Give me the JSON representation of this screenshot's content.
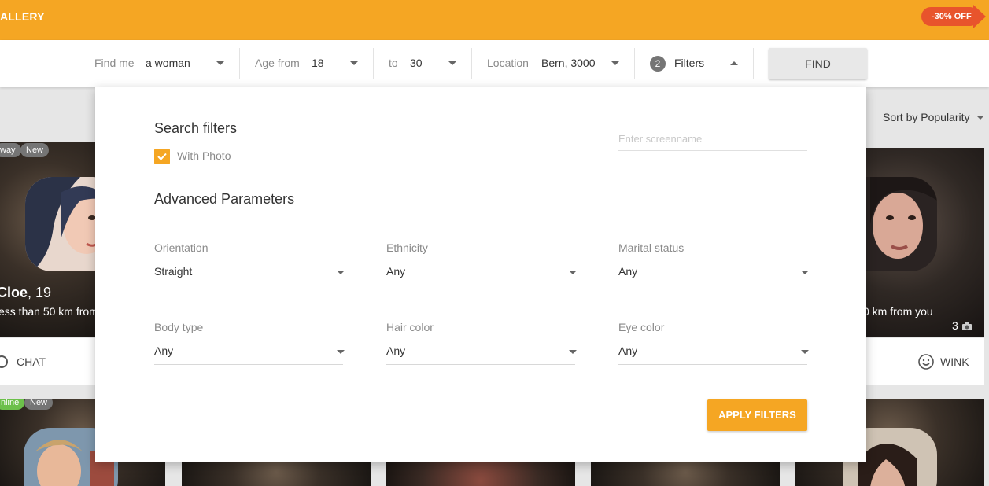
{
  "header": {
    "brand": "ALLERY",
    "promo": "-30% OFF"
  },
  "search": {
    "find_me_label": "Find me",
    "find_me_value": "a woman",
    "age_from_label": "Age from",
    "age_from_value": "18",
    "age_to_label": "to",
    "age_to_value": "30",
    "location_label": "Location",
    "location_value": "Bern, 3000",
    "filters_count": "2",
    "filters_label": "Filters",
    "find_button": "FIND"
  },
  "sort": {
    "label": "Sort by Popularity"
  },
  "cards": {
    "left": {
      "badge_1": "way",
      "badge_2": "New",
      "name": "Cloe",
      "age": ", 19",
      "distance": "ess than 50 km from",
      "action": "CHAT"
    },
    "right": {
      "distance": "0 km from you",
      "photo_count": "3",
      "action": "WINK"
    },
    "row2": {
      "badge_1": "nline",
      "badge_2": "New"
    }
  },
  "filter_panel": {
    "title": "Search filters",
    "with_photo_label": "With Photo",
    "with_photo_checked": true,
    "screenname_placeholder": "Enter screenname",
    "advanced_title": "Advanced Parameters",
    "params": [
      {
        "label": "Orientation",
        "value": "Straight"
      },
      {
        "label": "Ethnicity",
        "value": "Any"
      },
      {
        "label": "Marital status",
        "value": "Any"
      },
      {
        "label": "Body type",
        "value": "Any"
      },
      {
        "label": "Hair color",
        "value": "Any"
      },
      {
        "label": "Eye color",
        "value": "Any"
      }
    ],
    "apply_button": "APPLY FILTERS"
  },
  "colors": {
    "brand_orange": "#f5a623",
    "promo_red": "#e8542c",
    "online_green": "#6cc04a"
  }
}
